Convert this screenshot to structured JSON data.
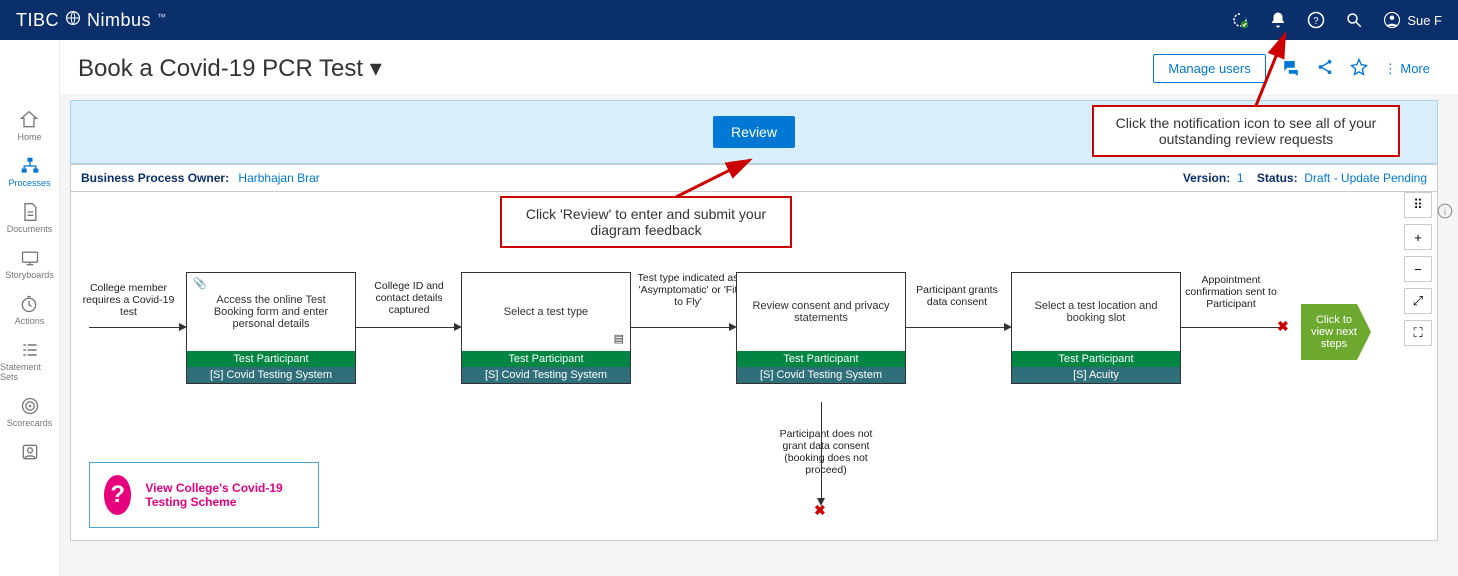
{
  "brand": {
    "t1": "TIBC",
    "o": "O",
    "t2": "Nimbus",
    "tm": "™"
  },
  "user": {
    "name": "Sue F"
  },
  "page": {
    "title": "Book a Covid-19 PCR Test  ▾"
  },
  "actions": {
    "manage": "Manage users",
    "more": "More"
  },
  "sidebar": [
    {
      "key": "home",
      "label": "Home"
    },
    {
      "key": "processes",
      "label": "Processes"
    },
    {
      "key": "documents",
      "label": "Documents"
    },
    {
      "key": "storyboards",
      "label": "Storyboards"
    },
    {
      "key": "actions",
      "label": "Actions"
    },
    {
      "key": "statementsets",
      "label": "Statement Sets"
    },
    {
      "key": "scorecards",
      "label": "Scorecards"
    },
    {
      "key": "profile",
      "label": ""
    }
  ],
  "banner": {
    "review": "Review"
  },
  "meta": {
    "owner_lbl": "Business Process Owner:",
    "owner_val": "Harbhajan Brar",
    "version_lbl": "Version:",
    "version_val": "1",
    "status_lbl": "Status:",
    "status_val": "Draft - Update Pending"
  },
  "flow": {
    "start": "College member requires a Covid-19 test",
    "b1": "Access the online Test Booking form and enter personal details",
    "l12": "College ID and contact details captured",
    "b2": "Select a test type",
    "l23": "Test type indicated as 'Asymptomatic' or 'Fit to Fly'",
    "b3": "Review consent and privacy statements",
    "l34": "Participant grants data consent",
    "b4": "Select a test location and booking slot",
    "l4e": "Appointment confirmation sent to Participant",
    "role": "Test Participant",
    "sysA": "[S] Covid Testing System",
    "sysB": "[S] Acuity",
    "down": "Participant does not grant data consent (booking does not proceed)",
    "next": "Click to view next steps"
  },
  "infoCard": {
    "text": "View College's Covid-19 Testing Scheme"
  },
  "callouts": {
    "c1": "Click 'Review' to enter and submit your diagram feedback",
    "c2": "Click the notification icon to see all of your outstanding review requests"
  }
}
